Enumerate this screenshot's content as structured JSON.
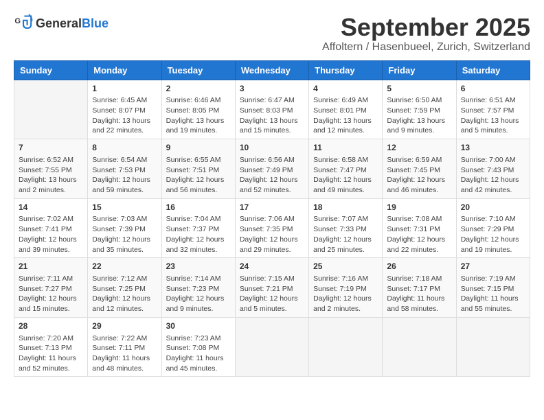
{
  "header": {
    "logo_general": "General",
    "logo_blue": "Blue",
    "month": "September 2025",
    "location": "Affoltern / Hasenbueel, Zurich, Switzerland"
  },
  "weekdays": [
    "Sunday",
    "Monday",
    "Tuesday",
    "Wednesday",
    "Thursday",
    "Friday",
    "Saturday"
  ],
  "weeks": [
    [
      {
        "day": "",
        "info": ""
      },
      {
        "day": "1",
        "info": "Sunrise: 6:45 AM\nSunset: 8:07 PM\nDaylight: 13 hours\nand 22 minutes."
      },
      {
        "day": "2",
        "info": "Sunrise: 6:46 AM\nSunset: 8:05 PM\nDaylight: 13 hours\nand 19 minutes."
      },
      {
        "day": "3",
        "info": "Sunrise: 6:47 AM\nSunset: 8:03 PM\nDaylight: 13 hours\nand 15 minutes."
      },
      {
        "day": "4",
        "info": "Sunrise: 6:49 AM\nSunset: 8:01 PM\nDaylight: 13 hours\nand 12 minutes."
      },
      {
        "day": "5",
        "info": "Sunrise: 6:50 AM\nSunset: 7:59 PM\nDaylight: 13 hours\nand 9 minutes."
      },
      {
        "day": "6",
        "info": "Sunrise: 6:51 AM\nSunset: 7:57 PM\nDaylight: 13 hours\nand 5 minutes."
      }
    ],
    [
      {
        "day": "7",
        "info": "Sunrise: 6:52 AM\nSunset: 7:55 PM\nDaylight: 13 hours\nand 2 minutes."
      },
      {
        "day": "8",
        "info": "Sunrise: 6:54 AM\nSunset: 7:53 PM\nDaylight: 12 hours\nand 59 minutes."
      },
      {
        "day": "9",
        "info": "Sunrise: 6:55 AM\nSunset: 7:51 PM\nDaylight: 12 hours\nand 56 minutes."
      },
      {
        "day": "10",
        "info": "Sunrise: 6:56 AM\nSunset: 7:49 PM\nDaylight: 12 hours\nand 52 minutes."
      },
      {
        "day": "11",
        "info": "Sunrise: 6:58 AM\nSunset: 7:47 PM\nDaylight: 12 hours\nand 49 minutes."
      },
      {
        "day": "12",
        "info": "Sunrise: 6:59 AM\nSunset: 7:45 PM\nDaylight: 12 hours\nand 46 minutes."
      },
      {
        "day": "13",
        "info": "Sunrise: 7:00 AM\nSunset: 7:43 PM\nDaylight: 12 hours\nand 42 minutes."
      }
    ],
    [
      {
        "day": "14",
        "info": "Sunrise: 7:02 AM\nSunset: 7:41 PM\nDaylight: 12 hours\nand 39 minutes."
      },
      {
        "day": "15",
        "info": "Sunrise: 7:03 AM\nSunset: 7:39 PM\nDaylight: 12 hours\nand 35 minutes."
      },
      {
        "day": "16",
        "info": "Sunrise: 7:04 AM\nSunset: 7:37 PM\nDaylight: 12 hours\nand 32 minutes."
      },
      {
        "day": "17",
        "info": "Sunrise: 7:06 AM\nSunset: 7:35 PM\nDaylight: 12 hours\nand 29 minutes."
      },
      {
        "day": "18",
        "info": "Sunrise: 7:07 AM\nSunset: 7:33 PM\nDaylight: 12 hours\nand 25 minutes."
      },
      {
        "day": "19",
        "info": "Sunrise: 7:08 AM\nSunset: 7:31 PM\nDaylight: 12 hours\nand 22 minutes."
      },
      {
        "day": "20",
        "info": "Sunrise: 7:10 AM\nSunset: 7:29 PM\nDaylight: 12 hours\nand 19 minutes."
      }
    ],
    [
      {
        "day": "21",
        "info": "Sunrise: 7:11 AM\nSunset: 7:27 PM\nDaylight: 12 hours\nand 15 minutes."
      },
      {
        "day": "22",
        "info": "Sunrise: 7:12 AM\nSunset: 7:25 PM\nDaylight: 12 hours\nand 12 minutes."
      },
      {
        "day": "23",
        "info": "Sunrise: 7:14 AM\nSunset: 7:23 PM\nDaylight: 12 hours\nand 9 minutes."
      },
      {
        "day": "24",
        "info": "Sunrise: 7:15 AM\nSunset: 7:21 PM\nDaylight: 12 hours\nand 5 minutes."
      },
      {
        "day": "25",
        "info": "Sunrise: 7:16 AM\nSunset: 7:19 PM\nDaylight: 12 hours\nand 2 minutes."
      },
      {
        "day": "26",
        "info": "Sunrise: 7:18 AM\nSunset: 7:17 PM\nDaylight: 11 hours\nand 58 minutes."
      },
      {
        "day": "27",
        "info": "Sunrise: 7:19 AM\nSunset: 7:15 PM\nDaylight: 11 hours\nand 55 minutes."
      }
    ],
    [
      {
        "day": "28",
        "info": "Sunrise: 7:20 AM\nSunset: 7:13 PM\nDaylight: 11 hours\nand 52 minutes."
      },
      {
        "day": "29",
        "info": "Sunrise: 7:22 AM\nSunset: 7:11 PM\nDaylight: 11 hours\nand 48 minutes."
      },
      {
        "day": "30",
        "info": "Sunrise: 7:23 AM\nSunset: 7:08 PM\nDaylight: 11 hours\nand 45 minutes."
      },
      {
        "day": "",
        "info": ""
      },
      {
        "day": "",
        "info": ""
      },
      {
        "day": "",
        "info": ""
      },
      {
        "day": "",
        "info": ""
      }
    ]
  ]
}
